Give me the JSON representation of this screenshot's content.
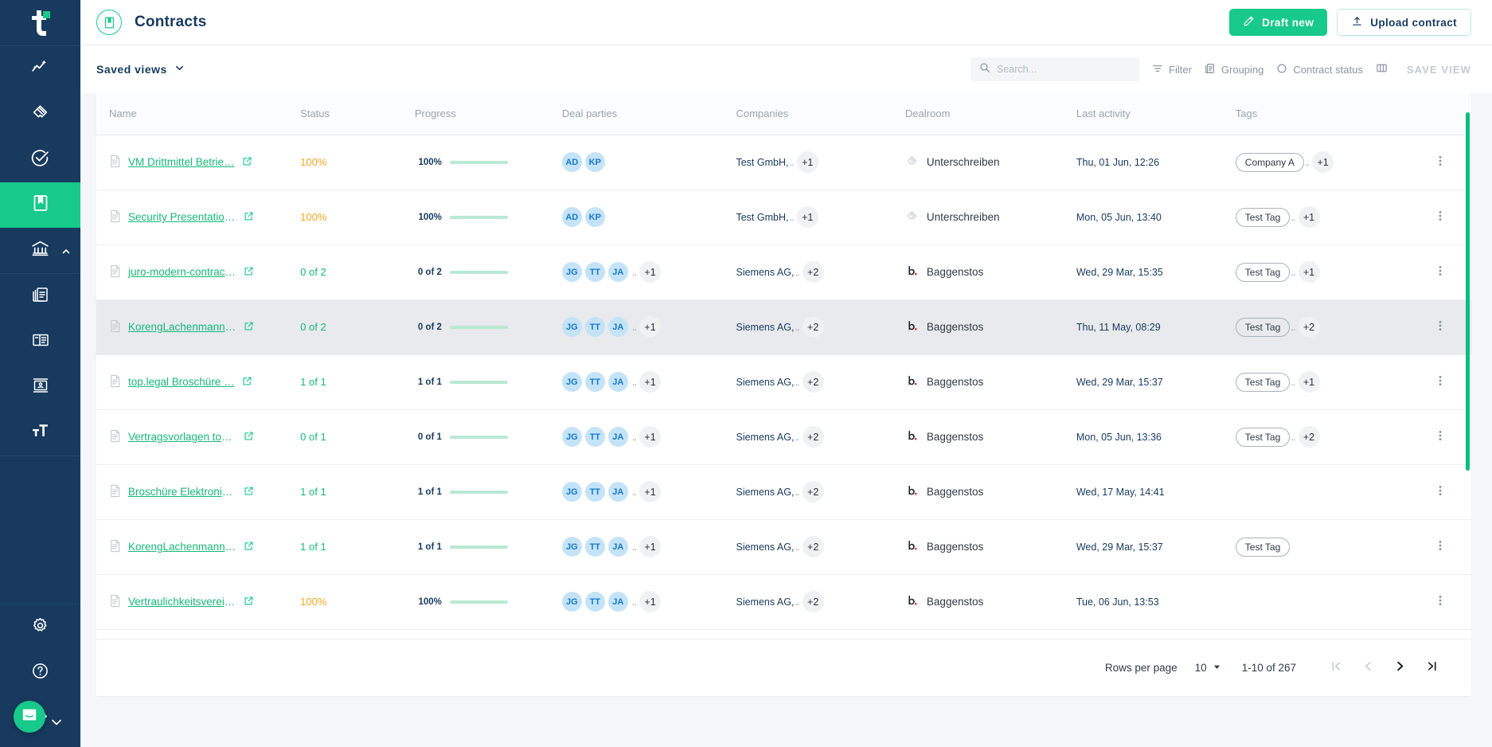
{
  "brand": {
    "logo_letter": "t",
    "accent_green": "#17c98a",
    "sidebar_navy": "#173a5e",
    "link_green": "#17b877",
    "status_orange": "#f5a623"
  },
  "sidebar": {
    "items": [
      {
        "icon": "ai-insights-icon",
        "name": "sidebar-item-insights",
        "active": false
      },
      {
        "icon": "handshake-icon",
        "name": "sidebar-item-deals",
        "active": false
      },
      {
        "icon": "check-circle-icon",
        "name": "sidebar-item-tasks",
        "active": false
      },
      {
        "icon": "bookmark-icon",
        "name": "sidebar-item-contracts",
        "active": true
      },
      {
        "icon": "bank-icon",
        "name": "sidebar-item-organization",
        "active": false
      },
      {
        "icon": "documents-icon",
        "name": "sidebar-item-templates",
        "active": false
      },
      {
        "icon": "layout-icon",
        "name": "sidebar-item-clauses",
        "active": false
      },
      {
        "icon": "contact-card-icon",
        "name": "sidebar-item-contacts",
        "active": false
      },
      {
        "icon": "text-format-icon",
        "name": "sidebar-item-text-styles",
        "active": false
      }
    ],
    "bottom_items": [
      {
        "icon": "gear-icon",
        "name": "sidebar-item-settings"
      },
      {
        "icon": "question-circle-icon",
        "name": "sidebar-item-help"
      },
      {
        "icon": "logout-icon",
        "name": "sidebar-item-logout"
      }
    ],
    "intercom": {
      "icon": "chat-bubble-icon",
      "chevron": "chevron-down-icon"
    }
  },
  "header": {
    "title": "Contracts",
    "title_icon": "contract-book-icon",
    "draft_new_label": "Draft new",
    "draft_new_icon": "pencil-icon",
    "upload_label": "Upload contract",
    "upload_icon": "upload-icon"
  },
  "viewbar": {
    "saved_views_label": "Saved views",
    "saved_views_chevron": "chevron-down-icon",
    "search": {
      "placeholder": "Search...",
      "value": "",
      "icon": "search-icon"
    },
    "tools": [
      {
        "label": "Filter",
        "icon": "filter-icon"
      },
      {
        "label": "Grouping",
        "icon": "grouping-icon"
      },
      {
        "label": "Contract status",
        "icon": "circle-icon"
      }
    ],
    "columns_icon": "columns-icon",
    "save_view_label": "SAVE VIEW"
  },
  "table": {
    "columns": [
      "Name",
      "Status",
      "Progress",
      "Deal parties",
      "Companies",
      "Dealroom",
      "Last activity",
      "Tags"
    ],
    "rows": [
      {
        "name": "VM Drittmittel Betrie…",
        "status": "100%",
        "status_color": "orange",
        "progress_label": "100%",
        "progress_pct": 100,
        "parties": [
          "AD",
          "KP"
        ],
        "parties_overflow": "",
        "company": "Test GmbH,",
        "company_overflow": "+1",
        "dealroom": "Unterschreiben",
        "dealroom_logo": "topshape-logo",
        "last_activity": "Thu, 01 Jun, 12:26",
        "tag": "Company A",
        "tag_overflow": "+1",
        "hovered": false
      },
      {
        "name": "Security Presentation…",
        "status": "100%",
        "status_color": "orange",
        "progress_label": "100%",
        "progress_pct": 100,
        "parties": [
          "AD",
          "KP"
        ],
        "parties_overflow": "",
        "company": "Test GmbH,",
        "company_overflow": "+1",
        "dealroom": "Unterschreiben",
        "dealroom_logo": "topshape-logo",
        "last_activity": "Mon, 05 Jun, 13:40",
        "tag": "Test Tag",
        "tag_overflow": "+1",
        "hovered": false
      },
      {
        "name": "juro-modern-contract…",
        "status": "0 of 2",
        "status_color": "green",
        "progress_label": "0 of 2",
        "progress_pct": 0,
        "parties": [
          "JG",
          "TT",
          "JA"
        ],
        "parties_overflow": "+1",
        "company": "Siemens AG,",
        "company_overflow": "+2",
        "dealroom": "Baggenstos",
        "dealroom_logo": "baggenstos-logo",
        "last_activity": "Wed, 29 Mar, 15:35",
        "tag": "Test Tag",
        "tag_overflow": "+1",
        "hovered": false
      },
      {
        "name": "KorengLachenmannF…",
        "status": "0 of 2",
        "status_color": "green",
        "progress_label": "0 of 2",
        "progress_pct": 0,
        "parties": [
          "JG",
          "TT",
          "JA"
        ],
        "parties_overflow": "+1",
        "company": "Siemens AG,",
        "company_overflow": "+2",
        "dealroom": "Baggenstos",
        "dealroom_logo": "baggenstos-logo",
        "last_activity": "Thu, 11 May, 08:29",
        "tag": "Test Tag",
        "tag_overflow": "+2",
        "hovered": true
      },
      {
        "name": "top.legal Broschüre …",
        "status": "1 of 1",
        "status_color": "green",
        "progress_label": "1 of 1",
        "progress_pct": 100,
        "parties": [
          "JG",
          "TT",
          "JA"
        ],
        "parties_overflow": "+1",
        "company": "Siemens AG,",
        "company_overflow": "+2",
        "dealroom": "Baggenstos",
        "dealroom_logo": "baggenstos-logo",
        "last_activity": "Wed, 29 Mar, 15:37",
        "tag": "Test Tag",
        "tag_overflow": "+1",
        "hovered": false
      },
      {
        "name": "Vertragsvorlagen top…",
        "status": "0 of 1",
        "status_color": "green",
        "progress_label": "0 of 1",
        "progress_pct": 0,
        "parties": [
          "JG",
          "TT",
          "JA"
        ],
        "parties_overflow": "+1",
        "company": "Siemens AG,",
        "company_overflow": "+2",
        "dealroom": "Baggenstos",
        "dealroom_logo": "baggenstos-logo",
        "last_activity": "Mon, 05 Jun, 13:36",
        "tag": "Test Tag",
        "tag_overflow": "+2",
        "hovered": false
      },
      {
        "name": "Broschüre Elektronis…",
        "status": "1 of 1",
        "status_color": "green",
        "progress_label": "1 of 1",
        "progress_pct": 100,
        "parties": [
          "JG",
          "TT",
          "JA"
        ],
        "parties_overflow": "+1",
        "company": "Siemens AG,",
        "company_overflow": "+2",
        "dealroom": "Baggenstos",
        "dealroom_logo": "baggenstos-logo",
        "last_activity": "Wed, 17 May, 14:41",
        "tag": "",
        "tag_overflow": "",
        "hovered": false
      },
      {
        "name": "KorengLachenmannF…",
        "status": "1 of 1",
        "status_color": "green",
        "progress_label": "1 of 1",
        "progress_pct": 100,
        "parties": [
          "JG",
          "TT",
          "JA"
        ],
        "parties_overflow": "+1",
        "company": "Siemens AG,",
        "company_overflow": "+2",
        "dealroom": "Baggenstos",
        "dealroom_logo": "baggenstos-logo",
        "last_activity": "Wed, 29 Mar, 15:37",
        "tag": "Test Tag",
        "tag_overflow": "",
        "hovered": false
      },
      {
        "name": "Vertraulichkeitsverein…",
        "status": "100%",
        "status_color": "orange",
        "progress_label": "100%",
        "progress_pct": 100,
        "parties": [
          "JG",
          "TT",
          "JA"
        ],
        "parties_overflow": "+1",
        "company": "Siemens AG,",
        "company_overflow": "+2",
        "dealroom": "Baggenstos",
        "dealroom_logo": "baggenstos-logo",
        "last_activity": "Tue, 06 Jun, 13:53",
        "tag": "",
        "tag_overflow": "",
        "hovered": false
      }
    ]
  },
  "pagination": {
    "rows_per_page_label": "Rows per page",
    "rows_per_page_value": "10",
    "range_label": "1-10 of 267",
    "first_icon": "first-page-icon",
    "prev_icon": "prev-page-icon",
    "next_icon": "next-page-icon",
    "last_icon": "last-page-icon"
  }
}
